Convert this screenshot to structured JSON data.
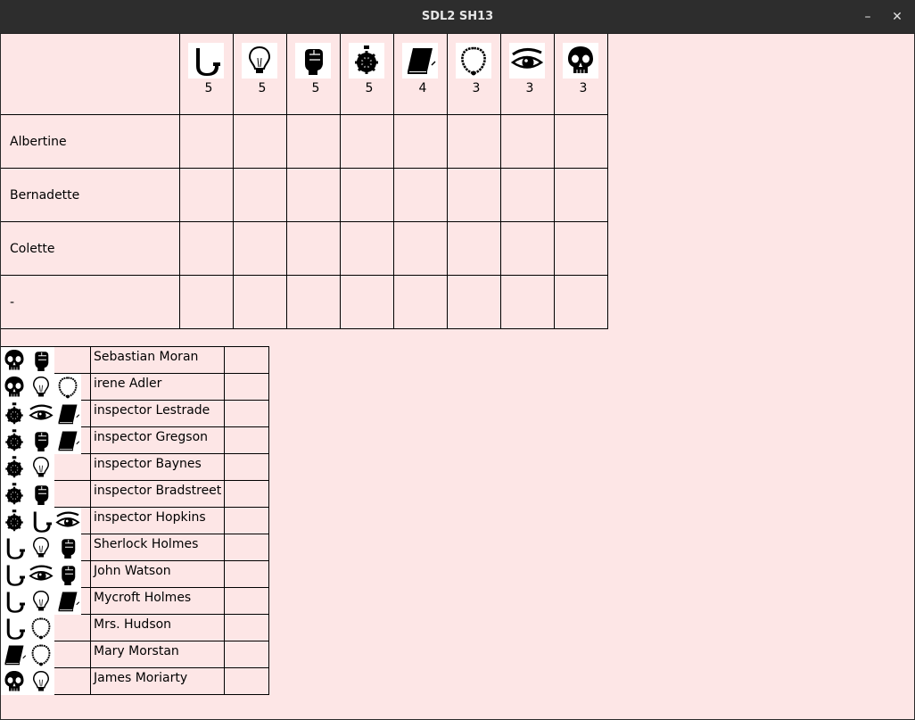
{
  "window": {
    "title": "SDL2 SH13"
  },
  "symbols": [
    {
      "name": "pipe-icon",
      "count": "5"
    },
    {
      "name": "bulb-icon",
      "count": "5"
    },
    {
      "name": "fist-icon",
      "count": "5"
    },
    {
      "name": "badge-icon",
      "count": "5"
    },
    {
      "name": "book-icon",
      "count": "4"
    },
    {
      "name": "necklace-icon",
      "count": "3"
    },
    {
      "name": "eye-icon",
      "count": "3"
    },
    {
      "name": "skull-icon",
      "count": "3"
    }
  ],
  "players": [
    "Albertine",
    "Bernadette",
    "Colette",
    "-"
  ],
  "suspects": [
    {
      "name": "Sebastian Moran",
      "icons": [
        "skull-icon",
        "fist-icon"
      ]
    },
    {
      "name": "irene Adler",
      "icons": [
        "skull-icon",
        "bulb-icon",
        "necklace-icon"
      ]
    },
    {
      "name": "inspector Lestrade",
      "icons": [
        "badge-icon",
        "eye-icon",
        "book-icon"
      ]
    },
    {
      "name": "inspector Gregson",
      "icons": [
        "badge-icon",
        "fist-icon",
        "book-icon"
      ]
    },
    {
      "name": "inspector Baynes",
      "icons": [
        "badge-icon",
        "bulb-icon"
      ]
    },
    {
      "name": "inspector Bradstreet",
      "icons": [
        "badge-icon",
        "fist-icon"
      ]
    },
    {
      "name": "inspector Hopkins",
      "icons": [
        "badge-icon",
        "pipe-icon",
        "eye-icon"
      ]
    },
    {
      "name": "Sherlock Holmes",
      "icons": [
        "pipe-icon",
        "bulb-icon",
        "fist-icon"
      ]
    },
    {
      "name": "John Watson",
      "icons": [
        "pipe-icon",
        "eye-icon",
        "fist-icon"
      ]
    },
    {
      "name": "Mycroft Holmes",
      "icons": [
        "pipe-icon",
        "bulb-icon",
        "book-icon"
      ]
    },
    {
      "name": "Mrs. Hudson",
      "icons": [
        "pipe-icon",
        "necklace-icon"
      ]
    },
    {
      "name": "Mary Morstan",
      "icons": [
        "book-icon",
        "necklace-icon"
      ]
    },
    {
      "name": "James Moriarty",
      "icons": [
        "skull-icon",
        "bulb-icon"
      ]
    }
  ],
  "colors": {
    "background": "#fde6e6",
    "grid": "#000000",
    "titlebar": "#2d2d2d"
  }
}
